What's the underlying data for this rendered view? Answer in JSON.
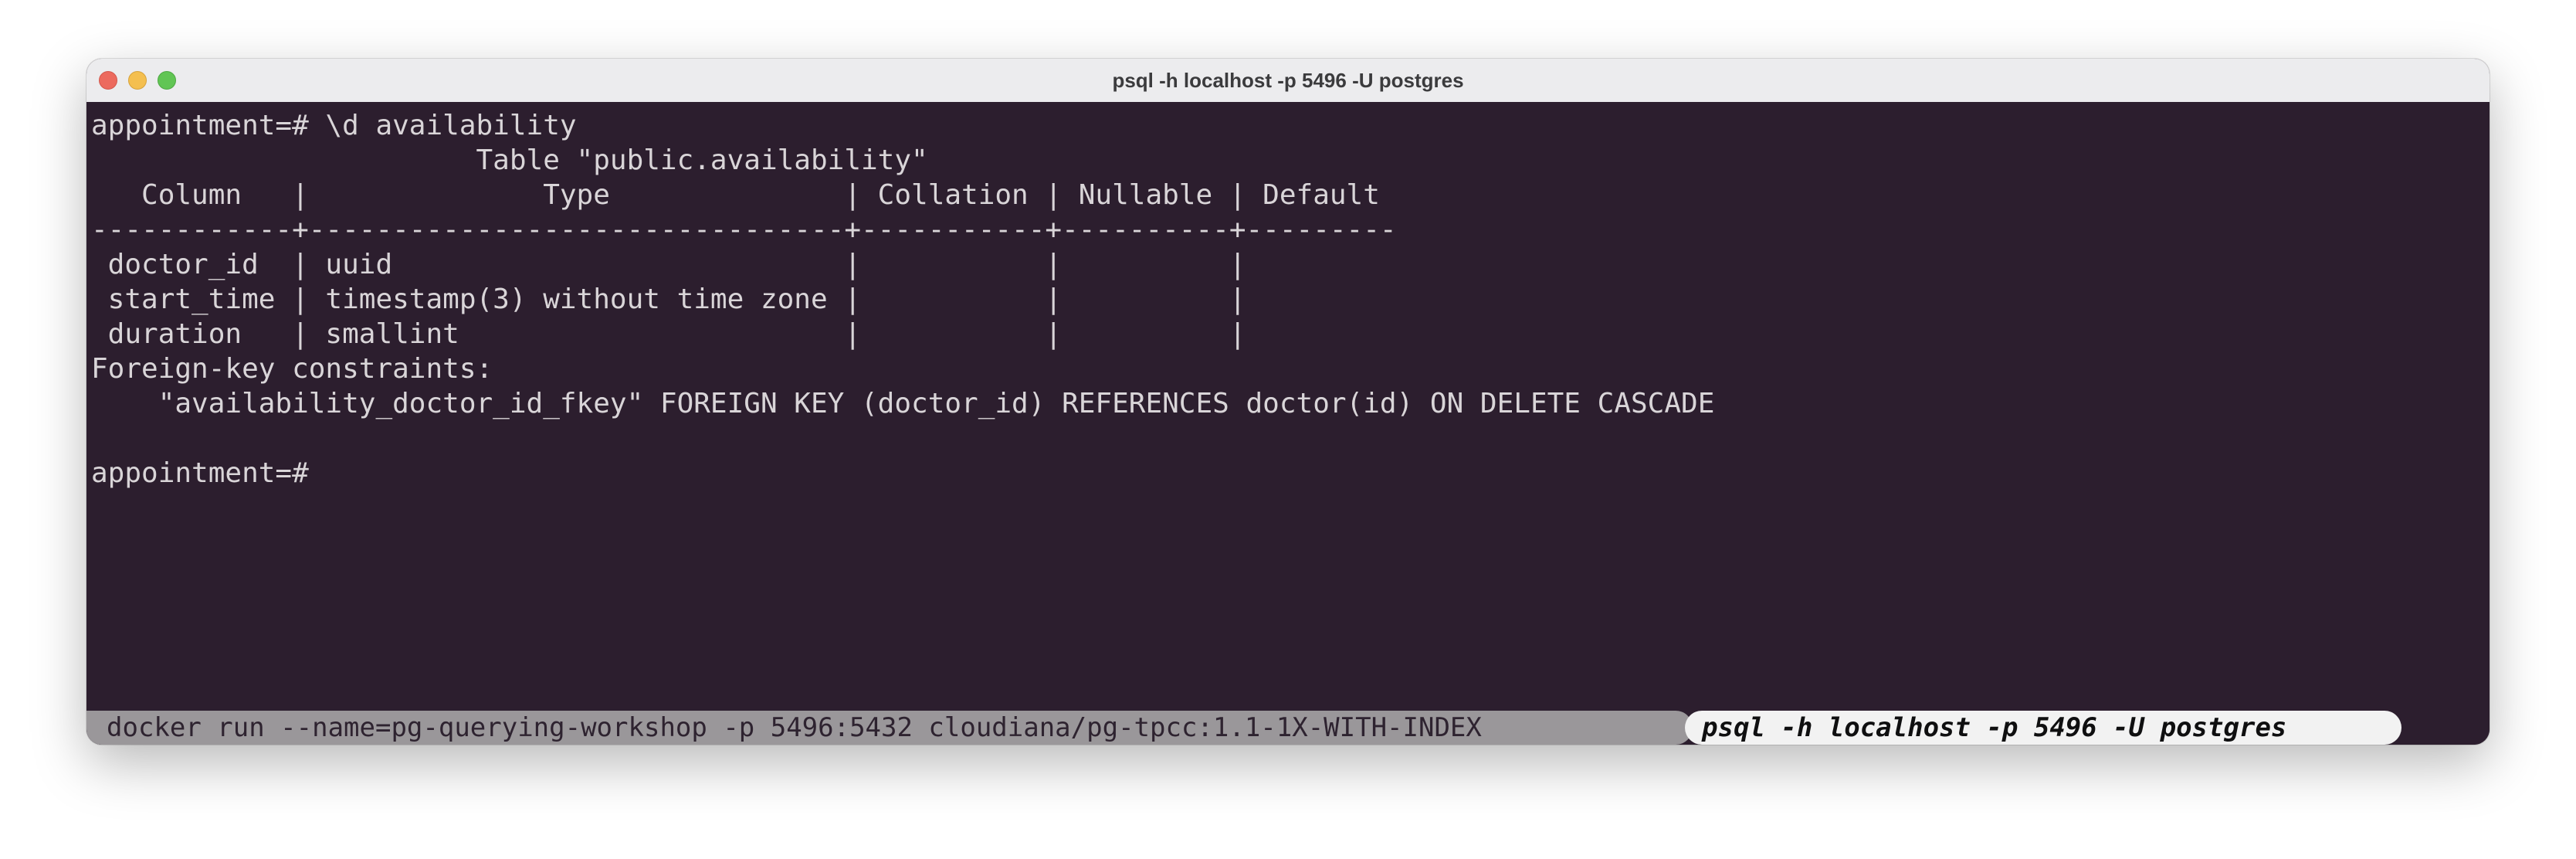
{
  "window": {
    "title": "psql -h localhost -p 5496 -U postgres"
  },
  "terminal": {
    "lines": [
      "appointment=# \\d availability",
      "                       Table \"public.availability\"",
      "   Column   |              Type              | Collation | Nullable | Default",
      "------------+--------------------------------+-----------+----------+---------",
      " doctor_id  | uuid                           |           |          |",
      " start_time | timestamp(3) without time zone |           |          |",
      " duration   | smallint                       |           |          |",
      "Foreign-key constraints:",
      "    \"availability_doctor_id_fkey\" FOREIGN KEY (doctor_id) REFERENCES doctor(id) ON DELETE CASCADE",
      "",
      "appointment=# "
    ]
  },
  "statusbar": {
    "inactive_tab": "docker run --name=pg-querying-workshop -p 5496:5432 cloudiana/pg-tpcc:1.1-1X-WITH-INDEX",
    "active_tab": "psql -h localhost -p 5496 -U postgres"
  },
  "colors": {
    "terminal_background": "#2c1e2e",
    "terminal_text": "#d9d5d8",
    "inactive_tab_background": "#9a979a",
    "active_tab_background": "#f2f2f2"
  }
}
